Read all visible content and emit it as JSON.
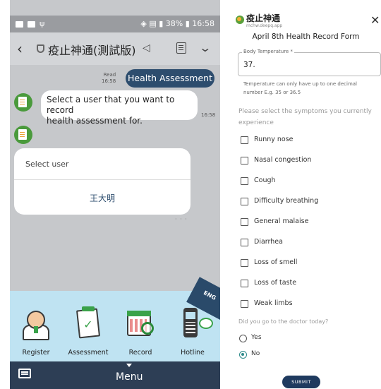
{
  "chat": {
    "statusbar": {
      "battery": "38%",
      "time": "16:58"
    },
    "header": {
      "back_icon": "back-arrow-icon",
      "title": "疫止神通(測試版)",
      "mute_icon": "speaker-mute-icon",
      "note_icon": "note-icon",
      "collapse_icon": "chevron-down-icon"
    },
    "messages": {
      "read_label": "Read",
      "read_time": "16:58",
      "user_msg": "Health Assessment",
      "bot_msg_line1": "Select a user that you want to record",
      "bot_msg_line2": "health assessment for.",
      "bot_msg_time": "16:58"
    },
    "card": {
      "label": "Select user",
      "user": "王大明"
    },
    "lang_badge": "ENG",
    "menu_items": [
      {
        "label": "Register",
        "icon": "register-icon"
      },
      {
        "label": "Assessment",
        "icon": "assessment-icon"
      },
      {
        "label": "Record",
        "icon": "record-icon"
      },
      {
        "label": "Hotline",
        "icon": "hotline-icon"
      }
    ],
    "bottom": {
      "menu_label": "Menu",
      "keyboard_icon": "keyboard-icon"
    }
  },
  "form": {
    "app_name": "疫止神通",
    "app_url": "mchw.deepq.app",
    "title": "April 8th Health Record Form",
    "temperature": {
      "label": "Body Temperature *",
      "value": "37.",
      "help_line1": "Temperature can only have up to one decimal",
      "help_line2": "number E.g. 35 or 36.5"
    },
    "symptom_prompt_line1": "Please select the symptoms you currently",
    "symptom_prompt_line2": "experience",
    "symptoms": [
      {
        "label": "Runny nose",
        "checked": false
      },
      {
        "label": "Nasal congestion",
        "checked": false
      },
      {
        "label": "Cough",
        "checked": false
      },
      {
        "label": "Difficulty breathing",
        "checked": false
      },
      {
        "label": "General malaise",
        "checked": false
      },
      {
        "label": "Diarrhea",
        "checked": false
      },
      {
        "label": "Loss of smell",
        "checked": false
      },
      {
        "label": "Loss of taste",
        "checked": false
      },
      {
        "label": "Weak limbs",
        "checked": false
      }
    ],
    "doctor_question": "Did you go to the doctor today?",
    "doctor_options": [
      {
        "label": "Yes",
        "selected": false
      },
      {
        "label": "No",
        "selected": true
      }
    ],
    "submit_label": "SUBMIT"
  }
}
